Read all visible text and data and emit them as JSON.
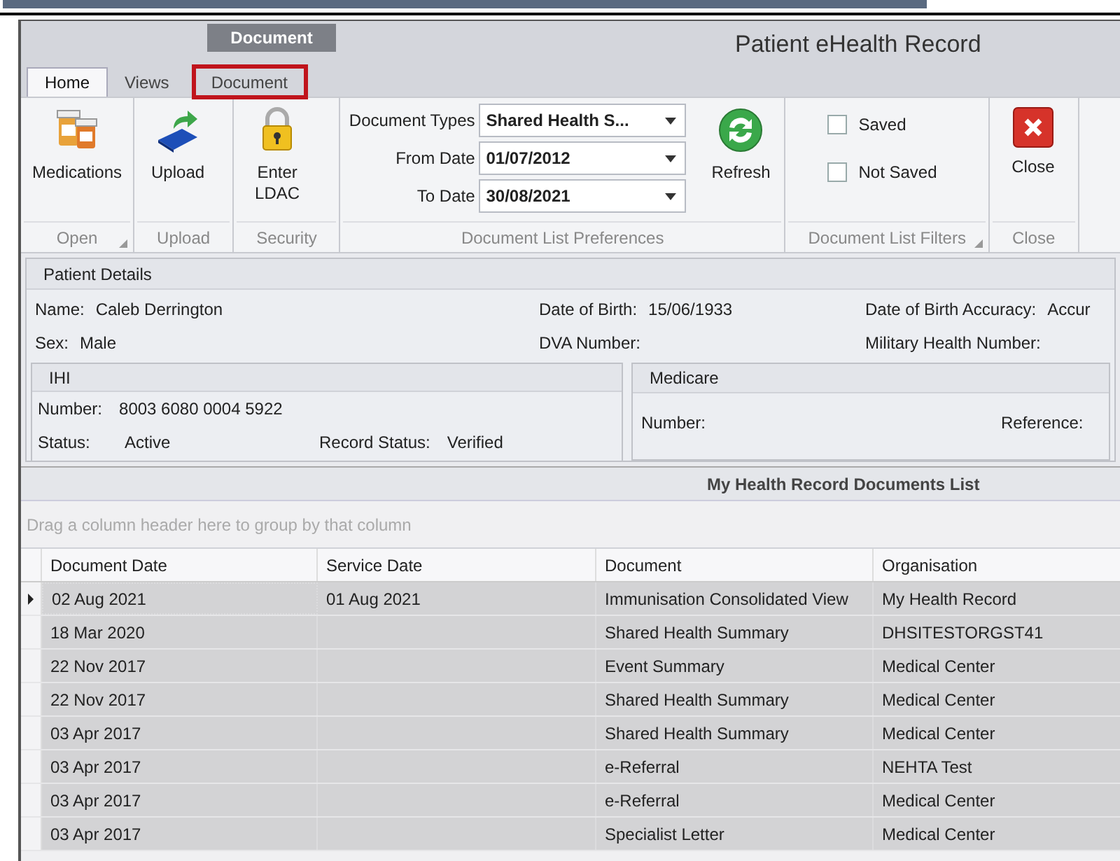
{
  "window": {
    "title": "Patient eHealth Record",
    "context_tab": "Document"
  },
  "tabs": [
    {
      "label": "Home",
      "selected": true,
      "highlighted": false
    },
    {
      "label": "Views",
      "selected": false,
      "highlighted": false
    },
    {
      "label": "Document",
      "selected": false,
      "highlighted": true
    }
  ],
  "ribbon": [
    {
      "caption": "Open",
      "launcher": true,
      "items": [
        {
          "kind": "medication",
          "label": "Medications"
        }
      ]
    },
    {
      "caption": "Upload",
      "launcher": false,
      "items": [
        {
          "kind": "upload",
          "label": "Upload"
        }
      ]
    },
    {
      "caption": "Security",
      "launcher": false,
      "items": [
        {
          "kind": "lock",
          "label": "Enter LDAC"
        }
      ]
    },
    {
      "caption": "Document List Preferences",
      "launcher": false,
      "items": [
        {
          "kind": "combo",
          "label": "Document Types",
          "value": "Shared Health S..."
        },
        {
          "kind": "combo",
          "label": "From Date",
          "value": "01/07/2012"
        },
        {
          "kind": "combo",
          "label": "To Date",
          "value": "30/08/2021"
        },
        {
          "kind": "refresh",
          "label": "Refresh"
        }
      ]
    },
    {
      "caption": "Document List Filters",
      "launcher": true,
      "items": [
        {
          "kind": "checkbox",
          "label": "Saved",
          "checked": false
        },
        {
          "kind": "checkbox",
          "label": "Not Saved",
          "checked": false
        }
      ]
    },
    {
      "caption": "Close",
      "launcher": false,
      "items": [
        {
          "kind": "close",
          "label": "Close"
        }
      ]
    }
  ],
  "patient_details": {
    "title": "Patient Details",
    "fields": [
      {
        "label": "Name:",
        "value": "Caleb Derrington"
      },
      {
        "label": "Date of Birth:",
        "value": "15/06/1933"
      },
      {
        "label": "Date of Birth Accuracy:",
        "value": "Accur"
      },
      {
        "label": "Sex:",
        "value": "Male"
      },
      {
        "label": "DVA Number:"
      },
      {
        "label": "Military Health Number:"
      }
    ],
    "ihi": {
      "title": "IHI",
      "number_label": "Number:",
      "number": "8003 6080 0004 5922",
      "status_label": "Status:",
      "status": "Active",
      "record_status_label": "Record Status:",
      "record_status": "Verified"
    },
    "medicare": {
      "title": "Medicare",
      "number_label": "Number:",
      "reference_label": "Reference:"
    }
  },
  "documents": {
    "title": "My Health Record Documents List",
    "group_hint": "Drag a column header here to group by that column",
    "columns": [
      "Document Date",
      "Service Date",
      "Document",
      "Organisation"
    ],
    "rows": [
      {
        "selected": true,
        "cells": [
          "02 Aug 2021",
          "01 Aug 2021",
          "Immunisation Consolidated View",
          "My Health Record"
        ]
      },
      {
        "selected": false,
        "cells": [
          "18 Mar 2020",
          "",
          "Shared Health Summary",
          "DHSITESTORGST41"
        ]
      },
      {
        "selected": false,
        "cells": [
          "22 Nov 2017",
          "",
          "Event Summary",
          "Medical Center"
        ]
      },
      {
        "selected": false,
        "cells": [
          "22 Nov 2017",
          "",
          "Shared Health Summary",
          "Medical Center"
        ]
      },
      {
        "selected": false,
        "cells": [
          "03 Apr 2017",
          "",
          "Shared Health Summary",
          "Medical Center"
        ]
      },
      {
        "selected": false,
        "cells": [
          "03 Apr 2017",
          "",
          "e-Referral",
          "NEHTA Test"
        ]
      },
      {
        "selected": false,
        "cells": [
          "03 Apr 2017",
          "",
          "e-Referral",
          "Medical Center"
        ]
      },
      {
        "selected": false,
        "cells": [
          "03 Apr 2017",
          "",
          "Specialist Letter",
          "Medical Center"
        ]
      }
    ]
  }
}
